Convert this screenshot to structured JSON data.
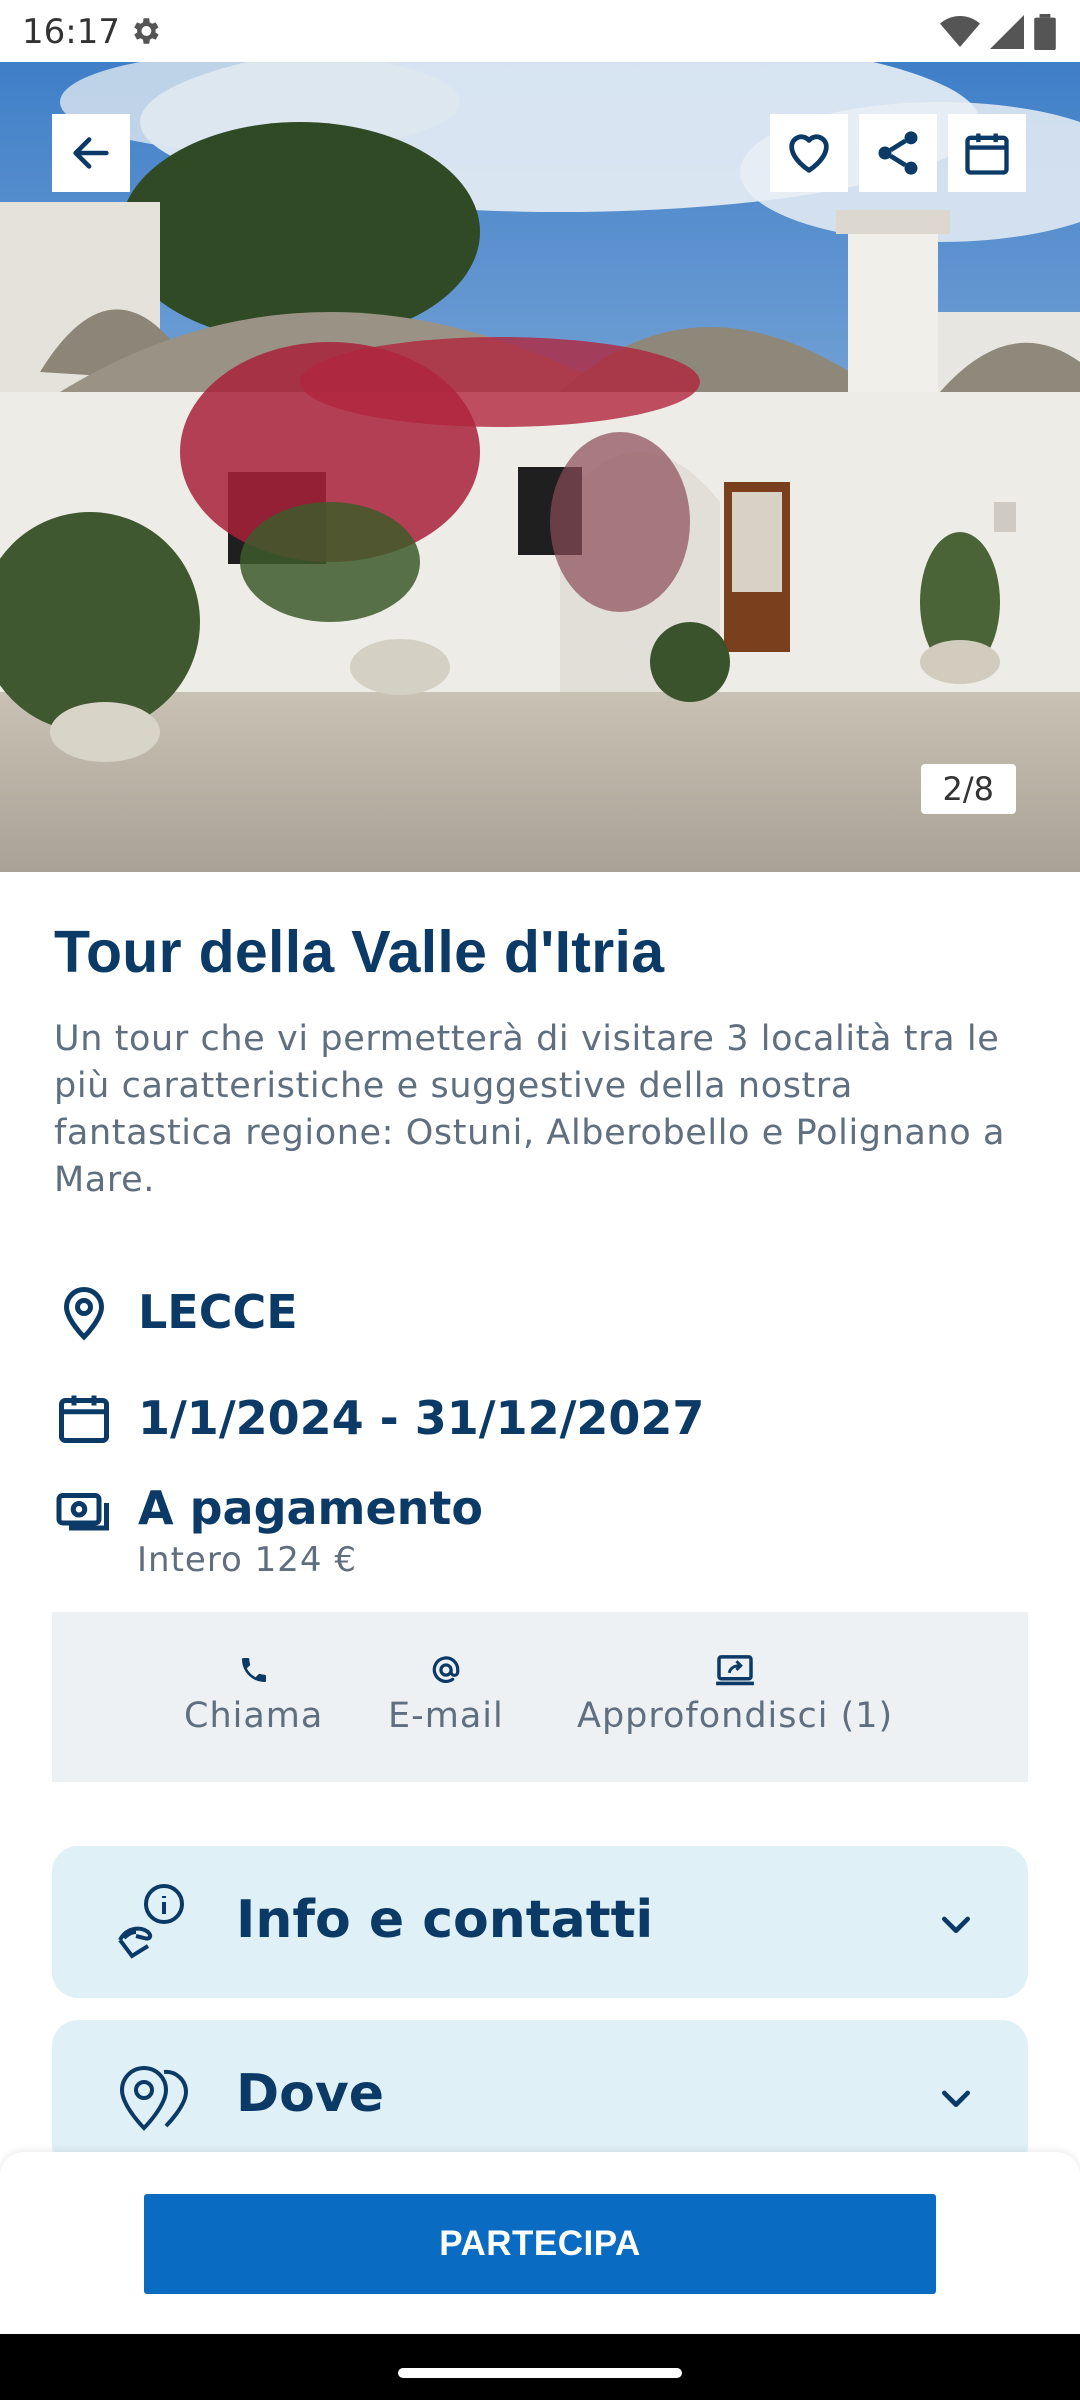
{
  "status": {
    "time": "16:17"
  },
  "hero": {
    "counter": "2/8",
    "icons": [
      "arrow-left-icon",
      "heart-icon",
      "share-icon",
      "calendar-icon"
    ]
  },
  "event": {
    "title": "Tour della Valle d'Itria",
    "description": "Un tour che vi permetterà di visitare 3 località tra le più caratteristiche e suggestive della nostra fantastica regione: Ostuni, Alberobello e Polignano a Mare.",
    "location": "LECCE",
    "dates": "1/1/2024 - 31/12/2027",
    "price_label": "A pagamento",
    "price_detail": "Intero 124 €"
  },
  "actions": {
    "call": "Chiama",
    "email": "E-mail",
    "more": "Approfondisci (1)"
  },
  "accordion": {
    "info": "Info e contatti",
    "where": "Dove"
  },
  "cta": "PARTECIPA",
  "colors": {
    "primary": "#0a6bc2",
    "title": "#0b3a66",
    "accordion_bg": "#dff0f6",
    "actions_bg": "#eef1f4"
  }
}
